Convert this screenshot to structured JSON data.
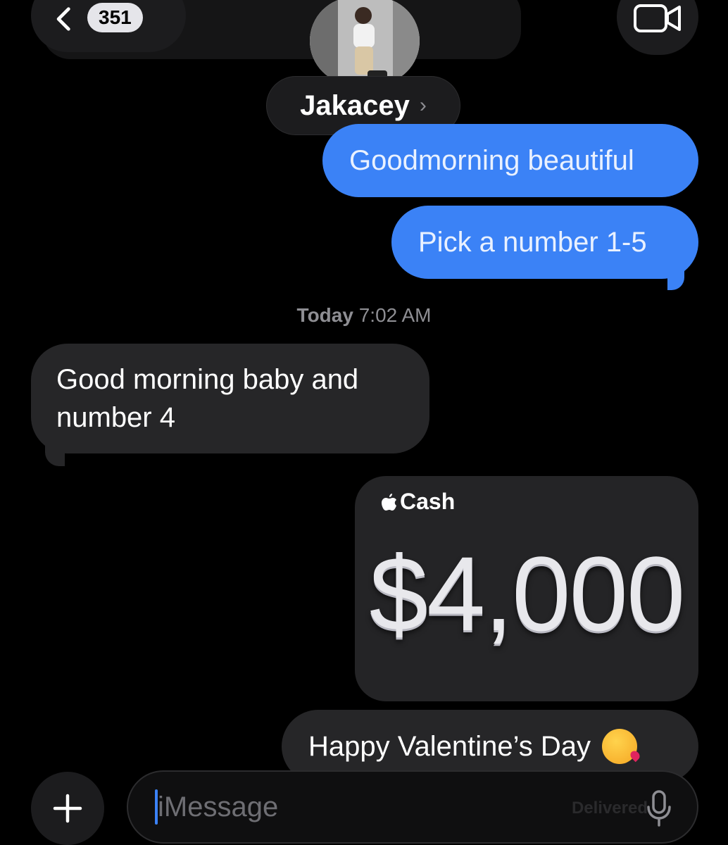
{
  "header": {
    "unread_count": "351",
    "contact_name": "Jakacey",
    "name_chevron": "›"
  },
  "messages": [
    {
      "id": "m1",
      "direction": "sent",
      "text": "Goodmorning beautiful"
    },
    {
      "id": "m2",
      "direction": "sent",
      "text": "Pick a number 1-5"
    },
    {
      "id": "m3",
      "direction": "received",
      "text": "Good morning baby and number 4"
    },
    {
      "id": "m5",
      "direction": "sent",
      "text": "Happy Valentine’s Day"
    }
  ],
  "timestamp": {
    "day": "Today",
    "time": "7:02 AM"
  },
  "apple_cash": {
    "brand": "Cash",
    "amount": "$4,000"
  },
  "composer": {
    "placeholder": "iMessage",
    "status": "Delivered"
  },
  "colors": {
    "sent_bubble": "#3b82f6",
    "received_bubble": "#262628",
    "background": "#000000"
  },
  "icons": {
    "back": "chevron-left-icon",
    "video": "video-camera-icon",
    "plus": "plus-icon",
    "mic": "microphone-icon",
    "apple": "apple-logo-icon",
    "emoji": "kissing-face-emoji"
  }
}
